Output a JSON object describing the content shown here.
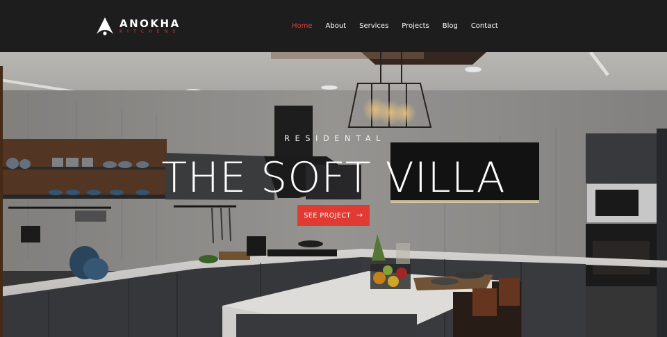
{
  "brand": {
    "name": "ANOKHA",
    "tagline": "KITCHENS",
    "logo_icon": "triangle-logo-icon",
    "accent_color": "#e03a33"
  },
  "nav": {
    "items": [
      {
        "label": "Home",
        "active": true
      },
      {
        "label": "About",
        "active": false
      },
      {
        "label": "Services",
        "active": false
      },
      {
        "label": "Projects",
        "active": false
      },
      {
        "label": "Blog",
        "active": false
      },
      {
        "label": "Contact",
        "active": false
      }
    ]
  },
  "hero": {
    "eyebrow": "RESIDENTAL",
    "title": "THE SOFT VILLA",
    "cta_label": "SEE PROJECT",
    "cta_icon": "arrow-right-icon"
  }
}
